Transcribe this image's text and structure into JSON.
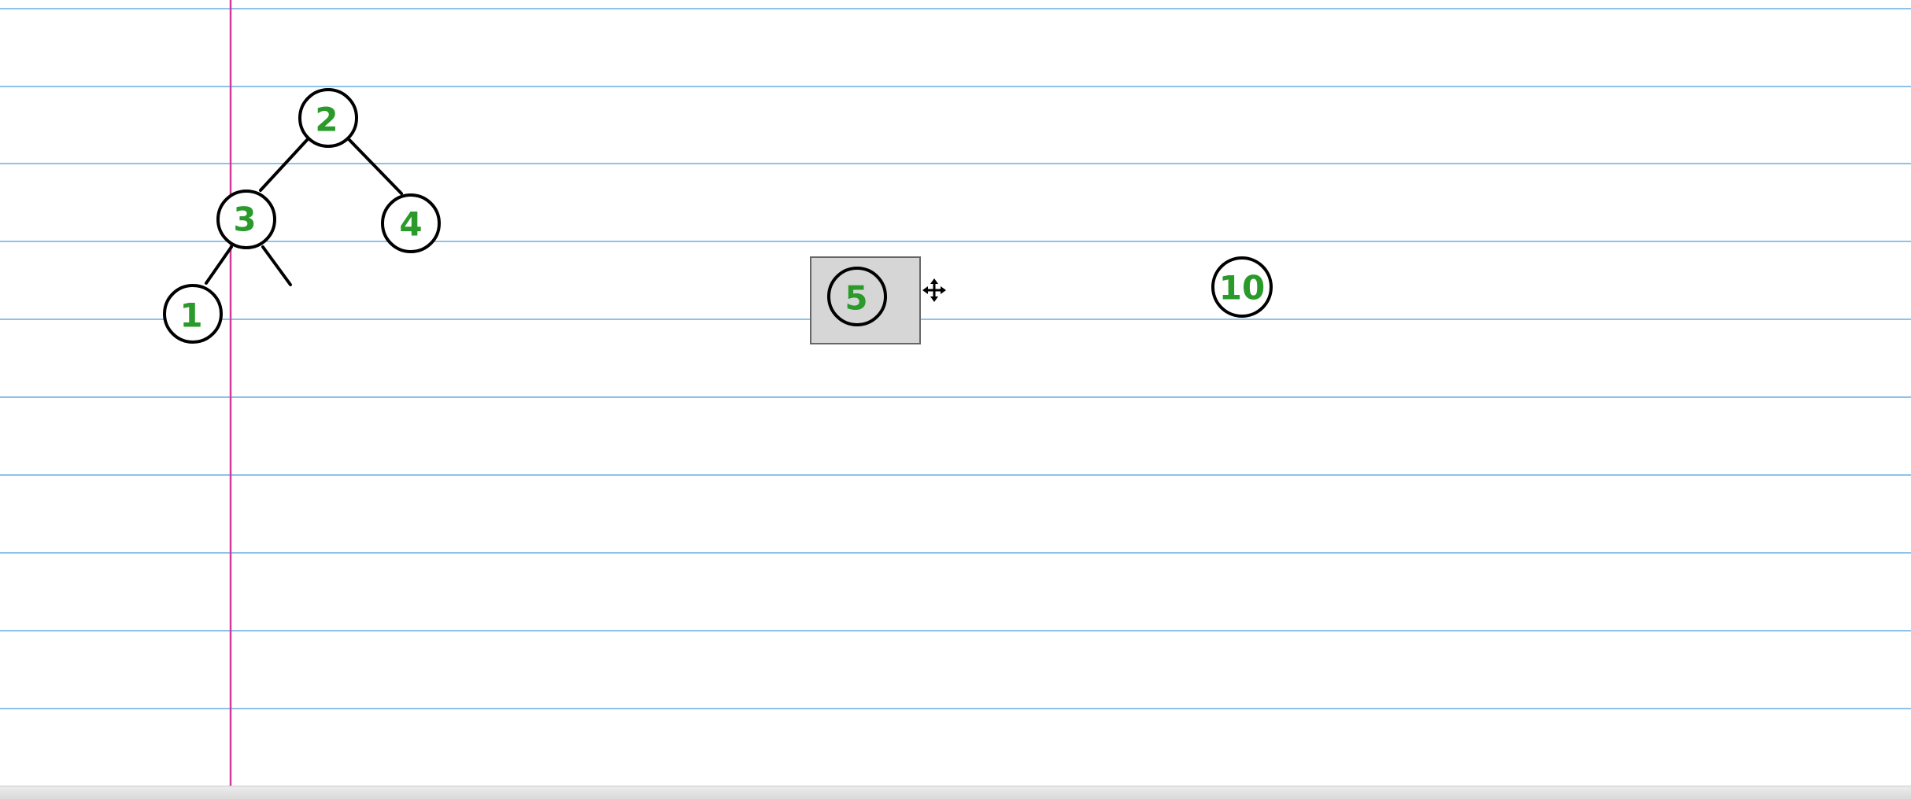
{
  "nodes": [
    {
      "id": "n2",
      "label": "2"
    },
    {
      "id": "n3",
      "label": "3"
    },
    {
      "id": "n4",
      "label": "4"
    },
    {
      "id": "n1",
      "label": "1"
    },
    {
      "id": "n5",
      "label": "5",
      "selected": true
    },
    {
      "id": "n10",
      "label": "10"
    }
  ],
  "colors": {
    "rule_line": "#8ec2ea",
    "margin_line": "#d43a9a",
    "node_text": "#2a9a2a",
    "stroke": "#000000",
    "selection_fill": "#d6d6d6",
    "selection_border": "#666666"
  },
  "icons": {
    "cursor": "move-cursor-icon"
  }
}
